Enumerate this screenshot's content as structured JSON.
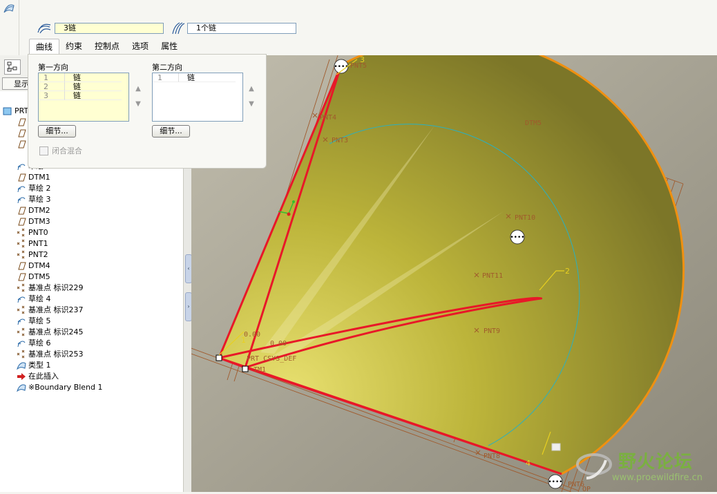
{
  "toolbar": {
    "collector_first": "3链",
    "collector_second": "1个链"
  },
  "tabs": [
    {
      "label": "曲线",
      "active": true
    },
    {
      "label": "约束"
    },
    {
      "label": "控制点"
    },
    {
      "label": "选项"
    },
    {
      "label": "属性"
    }
  ],
  "curves_panel": {
    "first_direction": {
      "label": "第一方向",
      "rows": [
        {
          "index": "1",
          "value": "链"
        },
        {
          "index": "2",
          "value": "链"
        },
        {
          "index": "3",
          "value": "链"
        }
      ],
      "details_button": "细节..."
    },
    "second_direction": {
      "label": "第二方向",
      "rows": [
        {
          "index": "1",
          "value": "链"
        }
      ],
      "details_button": "细节..."
    },
    "closed_blend_label": "闭合混合"
  },
  "model_tree": {
    "show_button": "显示",
    "partial_header": "PRT",
    "partial_item": "草绘 1",
    "items": [
      {
        "label": "DTM1",
        "icon": "datum-plane-icon"
      },
      {
        "label": "草绘 2",
        "icon": "sketch-icon"
      },
      {
        "label": "草绘 3",
        "icon": "sketch-icon"
      },
      {
        "label": "DTM2",
        "icon": "datum-plane-icon"
      },
      {
        "label": "DTM3",
        "icon": "datum-plane-icon"
      },
      {
        "label": "PNT0",
        "icon": "datum-point-icon"
      },
      {
        "label": "PNT1",
        "icon": "datum-point-icon"
      },
      {
        "label": "PNT2",
        "icon": "datum-point-icon"
      },
      {
        "label": "DTM4",
        "icon": "datum-plane-icon"
      },
      {
        "label": "DTM5",
        "icon": "datum-plane-icon"
      },
      {
        "label": "基准点 标识229",
        "icon": "datum-point-icon"
      },
      {
        "label": "草绘 4",
        "icon": "sketch-icon"
      },
      {
        "label": "基准点 标识237",
        "icon": "datum-point-icon"
      },
      {
        "label": "草绘 5",
        "icon": "sketch-icon"
      },
      {
        "label": "基准点 标识245",
        "icon": "datum-point-icon"
      },
      {
        "label": "草绘 6",
        "icon": "sketch-icon"
      },
      {
        "label": "基准点 标识253",
        "icon": "datum-point-icon"
      },
      {
        "label": "类型 1",
        "icon": "surface-icon"
      },
      {
        "label": "在此插入",
        "icon": "insert-here-icon"
      },
      {
        "label": "※Boundary Blend 1",
        "icon": "boundary-blend-icon"
      }
    ]
  },
  "viewport_labels": {
    "pnt5": "PNT5",
    "pnt4": "PNT4",
    "pnt3": "PNT3",
    "pnt10": "PNT10",
    "pnt11": "PNT11",
    "pnt9": "PNT9",
    "pnt8": "PNT8",
    "pnt6": "PNT6",
    "dtm5": "DTM5",
    "csys": "PRT_CSYS_DEF",
    "dtm_partial": "TM1",
    "top_partial": "OP",
    "dim1": "0.00",
    "dim2": "0.00",
    "num3": "3",
    "num2": "2",
    "num1": "1",
    "num4": "4"
  },
  "watermark": {
    "title": "野火论坛",
    "url": "www.proewildfire.cn"
  },
  "colors": {
    "surface_yellow": "#c8c040",
    "curve_red": "#e81828",
    "edge_orange": "#f09010",
    "datum_brown": "#a05a2c",
    "viewport_bg": "#b8b4a4"
  }
}
